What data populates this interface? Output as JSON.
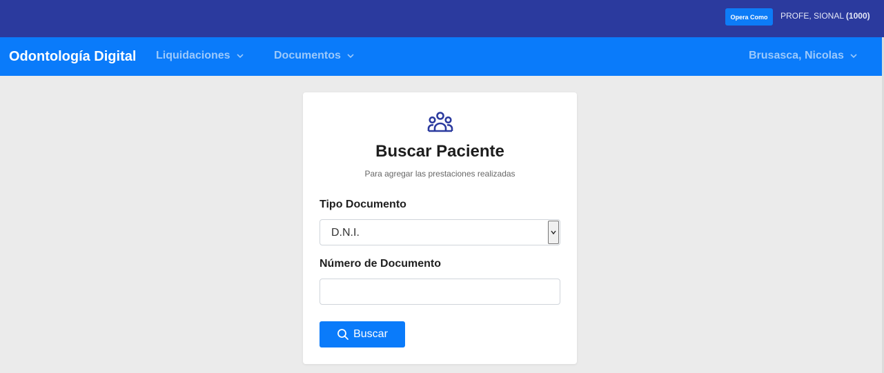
{
  "topbar": {
    "opera_como_label": "Opera Como",
    "user_code_name": "PROFE, SIONAL",
    "user_code_number": "(1000)"
  },
  "navbar": {
    "brand": "Odontología Digital",
    "items": [
      {
        "label": "Liquidaciones",
        "icon": "chevron-down-icon"
      },
      {
        "label": "Documentos",
        "icon": "chevron-down-icon"
      }
    ],
    "user_menu": {
      "label": "Brusasca, Nicolas",
      "icon": "chevron-down-icon"
    }
  },
  "card": {
    "icon": "users-group-icon",
    "title": "Buscar Paciente",
    "subtitle": "Para agregar las prestaciones realizadas",
    "tipo_documento_label": "Tipo Documento",
    "tipo_documento_value": "D.N.I.",
    "numero_documento_label": "Número de Documento",
    "numero_documento_value": "",
    "search_button_label": "Buscar",
    "search_button_icon": "search-icon"
  },
  "colors": {
    "topbar_bg": "#2b3a9e",
    "navbar_bg": "#0a7bfa",
    "accent": "#0a7bfa",
    "page_bg": "#ebebeb"
  }
}
